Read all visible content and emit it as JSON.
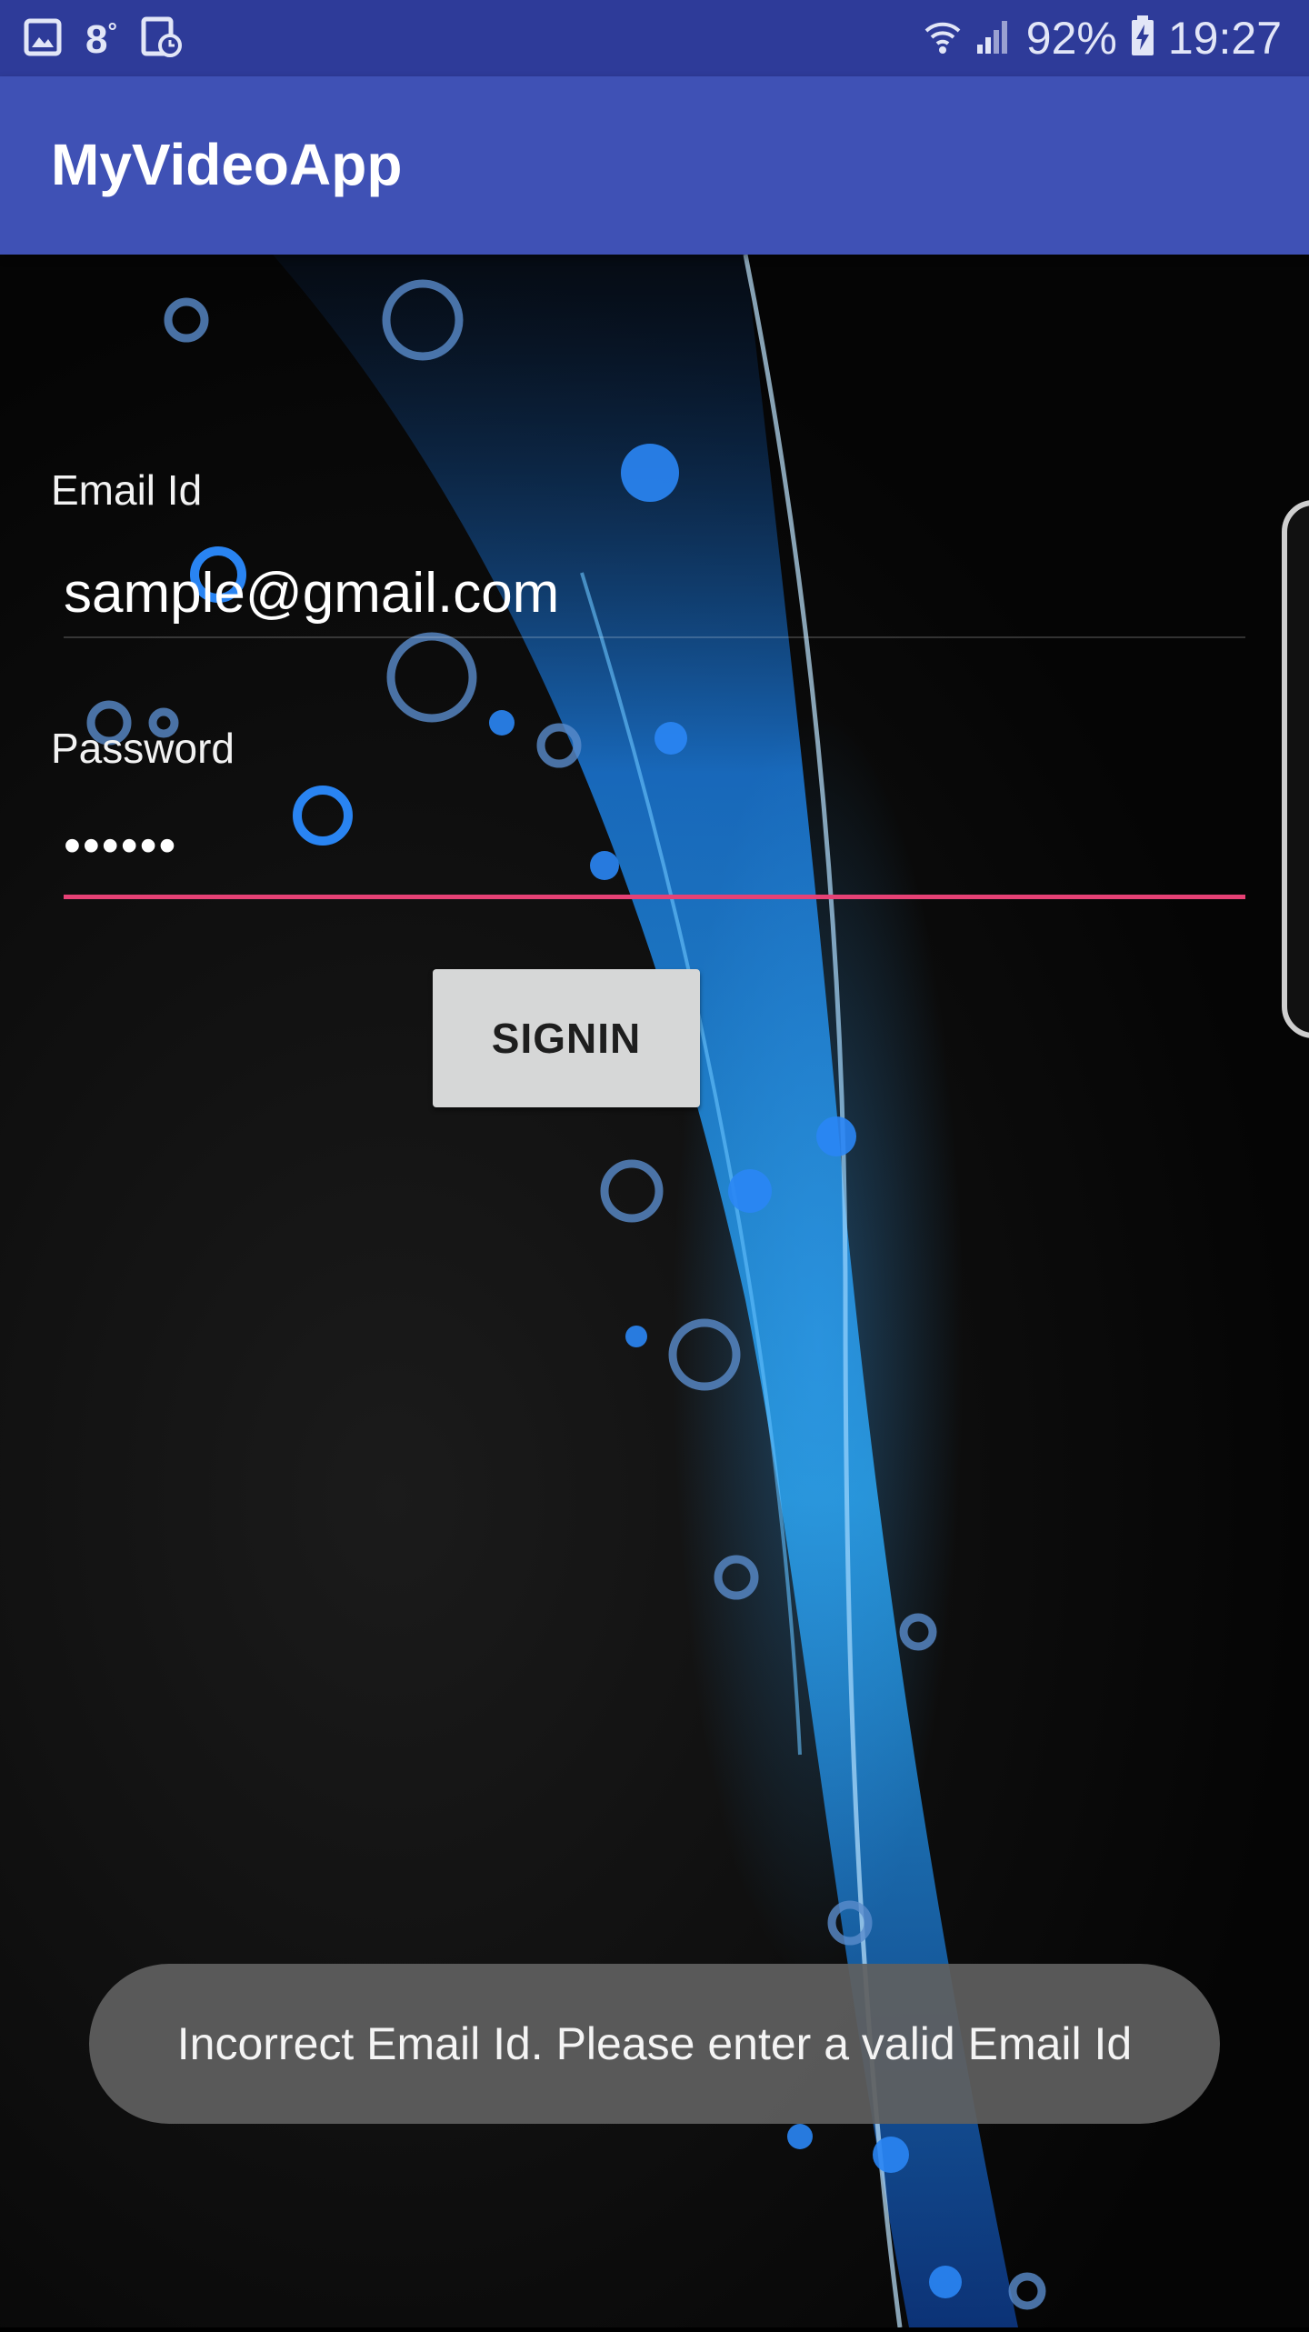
{
  "status_bar": {
    "notification_icons": [
      "gallery-icon",
      "weather-icon",
      "clock-icon"
    ],
    "temperature": "8",
    "temperature_degree": "°",
    "battery": "92%",
    "time": "19:27",
    "indicator_icons": [
      "wifi-icon",
      "signal-icon",
      "battery-charging-icon"
    ]
  },
  "app_bar": {
    "title": "MyVideoApp",
    "background_color": "#3f51b5"
  },
  "form": {
    "email_label": "Email Id",
    "email_value": "sample@gmail.com",
    "password_label": "Password",
    "password_value": "••••••",
    "signin_label": "SIGNIN",
    "accent_color": "#e64175"
  },
  "toast": {
    "message": "Incorrect Email Id. Please enter a valid Email Id"
  }
}
